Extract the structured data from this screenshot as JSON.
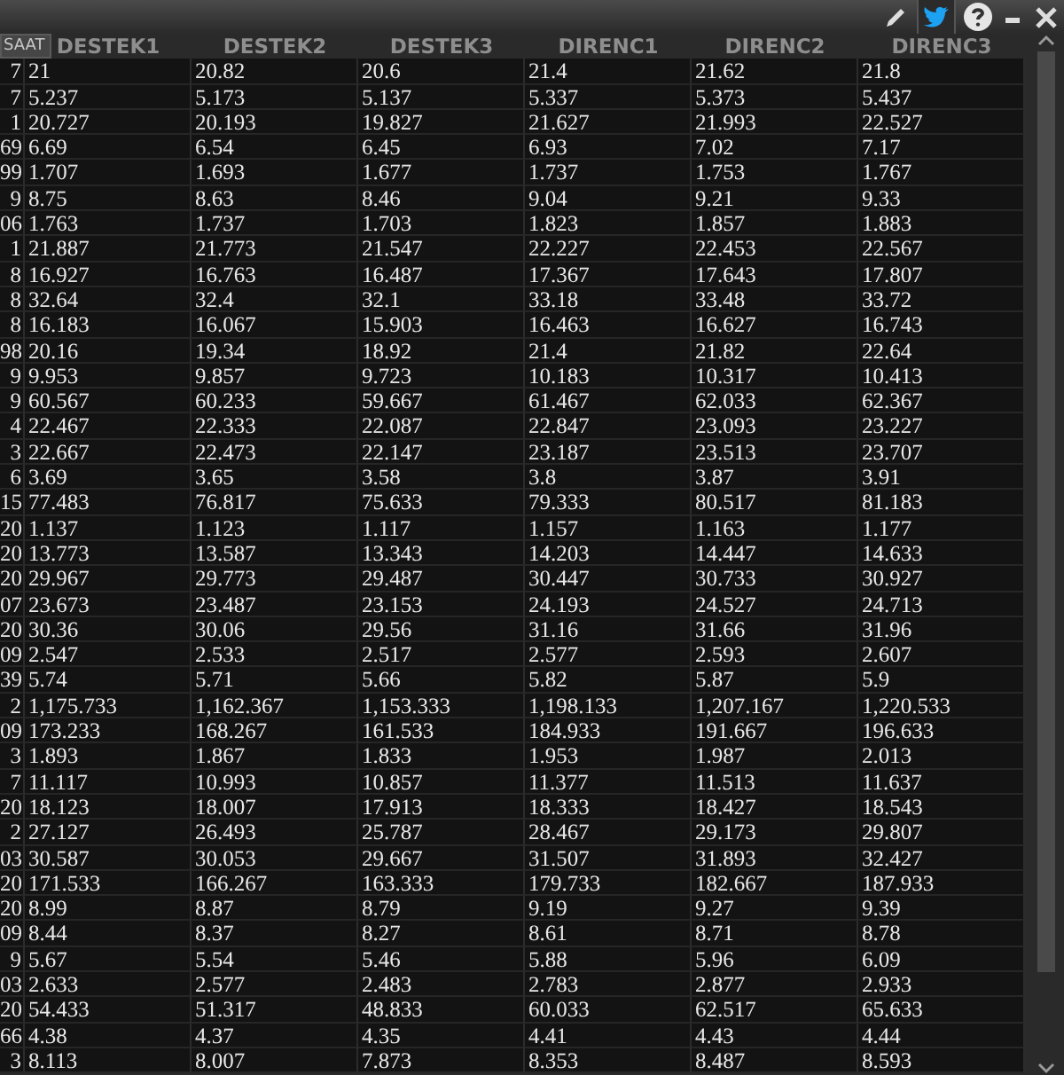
{
  "tooltip": {
    "text": "SAAT"
  },
  "table": {
    "columns": [
      "DESTEK1",
      "DESTEK2",
      "DESTEK3",
      "DIRENC1",
      "DIRENC2",
      "DIRENC3"
    ],
    "rows": [
      {
        "column_0": "7",
        "cells": [
          "21",
          "20.82",
          "20.6",
          "21.4",
          "21.62",
          "21.8"
        ]
      },
      {
        "column_0": "7",
        "cells": [
          "5.237",
          "5.173",
          "5.137",
          "5.337",
          "5.373",
          "5.437"
        ]
      },
      {
        "column_0": "1",
        "cells": [
          "20.727",
          "20.193",
          "19.827",
          "21.627",
          "21.993",
          "22.527"
        ]
      },
      {
        "column_0": "69",
        "cells": [
          "6.69",
          "6.54",
          "6.45",
          "6.93",
          "7.02",
          "7.17"
        ]
      },
      {
        "column_0": "99",
        "cells": [
          "1.707",
          "1.693",
          "1.677",
          "1.737",
          "1.753",
          "1.767"
        ]
      },
      {
        "column_0": "9",
        "cells": [
          "8.75",
          "8.63",
          "8.46",
          "9.04",
          "9.21",
          "9.33"
        ]
      },
      {
        "column_0": "06",
        "cells": [
          "1.763",
          "1.737",
          "1.703",
          "1.823",
          "1.857",
          "1.883"
        ]
      },
      {
        "column_0": "1",
        "cells": [
          "21.887",
          "21.773",
          "21.547",
          "22.227",
          "22.453",
          "22.567"
        ]
      },
      {
        "column_0": "8",
        "cells": [
          "16.927",
          "16.763",
          "16.487",
          "17.367",
          "17.643",
          "17.807"
        ]
      },
      {
        "column_0": "8",
        "cells": [
          "32.64",
          "32.4",
          "32.1",
          "33.18",
          "33.48",
          "33.72"
        ]
      },
      {
        "column_0": "8",
        "cells": [
          "16.183",
          "16.067",
          "15.903",
          "16.463",
          "16.627",
          "16.743"
        ]
      },
      {
        "column_0": "98",
        "cells": [
          "20.16",
          "19.34",
          "18.92",
          "21.4",
          "21.82",
          "22.64"
        ]
      },
      {
        "column_0": "9",
        "cells": [
          "9.953",
          "9.857",
          "9.723",
          "10.183",
          "10.317",
          "10.413"
        ]
      },
      {
        "column_0": "9",
        "cells": [
          "60.567",
          "60.233",
          "59.667",
          "61.467",
          "62.033",
          "62.367"
        ]
      },
      {
        "column_0": "4",
        "cells": [
          "22.467",
          "22.333",
          "22.087",
          "22.847",
          "23.093",
          "23.227"
        ]
      },
      {
        "column_0": "3",
        "cells": [
          "22.667",
          "22.473",
          "22.147",
          "23.187",
          "23.513",
          "23.707"
        ]
      },
      {
        "column_0": "6",
        "cells": [
          "3.69",
          "3.65",
          "3.58",
          "3.8",
          "3.87",
          "3.91"
        ]
      },
      {
        "column_0": "15",
        "cells": [
          "77.483",
          "76.817",
          "75.633",
          "79.333",
          "80.517",
          "81.183"
        ]
      },
      {
        "column_0": "20",
        "cells": [
          "1.137",
          "1.123",
          "1.117",
          "1.157",
          "1.163",
          "1.177"
        ]
      },
      {
        "column_0": "20",
        "cells": [
          "13.773",
          "13.587",
          "13.343",
          "14.203",
          "14.447",
          "14.633"
        ]
      },
      {
        "column_0": "20",
        "cells": [
          "29.967",
          "29.773",
          "29.487",
          "30.447",
          "30.733",
          "30.927"
        ]
      },
      {
        "column_0": "07",
        "cells": [
          "23.673",
          "23.487",
          "23.153",
          "24.193",
          "24.527",
          "24.713"
        ]
      },
      {
        "column_0": "20",
        "cells": [
          "30.36",
          "30.06",
          "29.56",
          "31.16",
          "31.66",
          "31.96"
        ]
      },
      {
        "column_0": "09",
        "cells": [
          "2.547",
          "2.533",
          "2.517",
          "2.577",
          "2.593",
          "2.607"
        ]
      },
      {
        "column_0": "39",
        "cells": [
          "5.74",
          "5.71",
          "5.66",
          "5.82",
          "5.87",
          "5.9"
        ]
      },
      {
        "column_0": "2",
        "cells": [
          "1,175.733",
          "1,162.367",
          "1,153.333",
          "1,198.133",
          "1,207.167",
          "1,220.533"
        ]
      },
      {
        "column_0": "09",
        "cells": [
          "173.233",
          "168.267",
          "161.533",
          "184.933",
          "191.667",
          "196.633"
        ]
      },
      {
        "column_0": "3",
        "cells": [
          "1.893",
          "1.867",
          "1.833",
          "1.953",
          "1.987",
          "2.013"
        ]
      },
      {
        "column_0": "7",
        "cells": [
          "11.117",
          "10.993",
          "10.857",
          "11.377",
          "11.513",
          "11.637"
        ]
      },
      {
        "column_0": "20",
        "cells": [
          "18.123",
          "18.007",
          "17.913",
          "18.333",
          "18.427",
          "18.543"
        ]
      },
      {
        "column_0": "2",
        "cells": [
          "27.127",
          "26.493",
          "25.787",
          "28.467",
          "29.173",
          "29.807"
        ]
      },
      {
        "column_0": "03",
        "cells": [
          "30.587",
          "30.053",
          "29.667",
          "31.507",
          "31.893",
          "32.427"
        ]
      },
      {
        "column_0": "20",
        "cells": [
          "171.533",
          "166.267",
          "163.333",
          "179.733",
          "182.667",
          "187.933"
        ]
      },
      {
        "column_0": "20",
        "cells": [
          "8.99",
          "8.87",
          "8.79",
          "9.19",
          "9.27",
          "9.39"
        ]
      },
      {
        "column_0": "09",
        "cells": [
          "8.44",
          "8.37",
          "8.27",
          "8.61",
          "8.71",
          "8.78"
        ]
      },
      {
        "column_0": "9",
        "cells": [
          "5.67",
          "5.54",
          "5.46",
          "5.88",
          "5.96",
          "6.09"
        ]
      },
      {
        "column_0": "03",
        "cells": [
          "2.633",
          "2.577",
          "2.483",
          "2.783",
          "2.877",
          "2.933"
        ]
      },
      {
        "column_0": "20",
        "cells": [
          "54.433",
          "51.317",
          "48.833",
          "60.033",
          "62.517",
          "65.633"
        ]
      },
      {
        "column_0": "66",
        "cells": [
          "4.38",
          "4.37",
          "4.35",
          "4.41",
          "4.43",
          "4.44"
        ]
      },
      {
        "column_0": "3",
        "cells": [
          "8.113",
          "8.007",
          "7.873",
          "8.353",
          "8.487",
          "8.593"
        ]
      }
    ]
  }
}
